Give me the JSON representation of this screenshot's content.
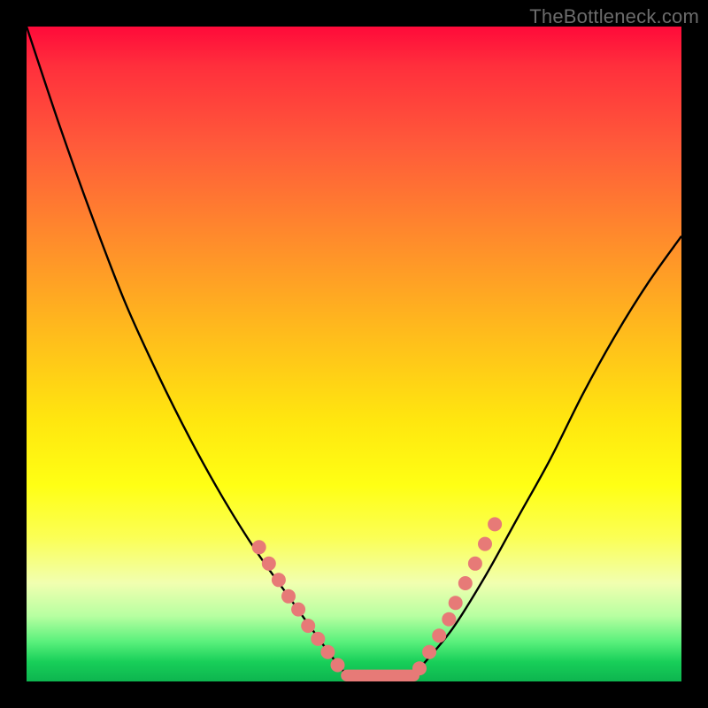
{
  "watermark": {
    "text": "TheBottleneck.com"
  },
  "chart_data": {
    "type": "line",
    "title": "",
    "xlabel": "",
    "ylabel": "",
    "xlim": [
      0,
      100
    ],
    "ylim": [
      0,
      100
    ],
    "series": [
      {
        "name": "curve-left",
        "x": [
          0,
          5,
          10,
          15,
          20,
          25,
          30,
          35,
          40,
          45,
          48,
          50
        ],
        "values": [
          100,
          85,
          71,
          58,
          47,
          37,
          28,
          20,
          13,
          6,
          2,
          0
        ]
      },
      {
        "name": "curve-right",
        "x": [
          58,
          60,
          65,
          70,
          75,
          80,
          85,
          90,
          95,
          100
        ],
        "values": [
          0,
          2,
          8,
          16,
          25,
          34,
          44,
          53,
          61,
          68
        ]
      },
      {
        "name": "flat-bottom",
        "x": [
          50,
          58
        ],
        "values": [
          0,
          0
        ]
      }
    ],
    "dots_left": [
      {
        "x": 35.5,
        "y": 20.5
      },
      {
        "x": 37.0,
        "y": 18.0
      },
      {
        "x": 38.5,
        "y": 15.5
      },
      {
        "x": 40.0,
        "y": 13.0
      },
      {
        "x": 41.5,
        "y": 11.0
      },
      {
        "x": 43.0,
        "y": 8.5
      },
      {
        "x": 44.5,
        "y": 6.5
      },
      {
        "x": 46.0,
        "y": 4.5
      },
      {
        "x": 47.5,
        "y": 2.5
      }
    ],
    "dots_right": [
      {
        "x": 60.0,
        "y": 2.0
      },
      {
        "x": 61.5,
        "y": 4.5
      },
      {
        "x": 63.0,
        "y": 7.0
      },
      {
        "x": 64.5,
        "y": 9.5
      },
      {
        "x": 65.5,
        "y": 12.0
      },
      {
        "x": 67.0,
        "y": 15.0
      },
      {
        "x": 68.5,
        "y": 18.0
      },
      {
        "x": 70.0,
        "y": 21.0
      },
      {
        "x": 71.5,
        "y": 24.0
      }
    ],
    "bottom_bar": {
      "x0": 48,
      "x1": 60,
      "y": 0,
      "h": 1.8
    },
    "colors": {
      "curve": "#000000",
      "dot": "#e77a77",
      "bar": "#e77a77"
    }
  }
}
